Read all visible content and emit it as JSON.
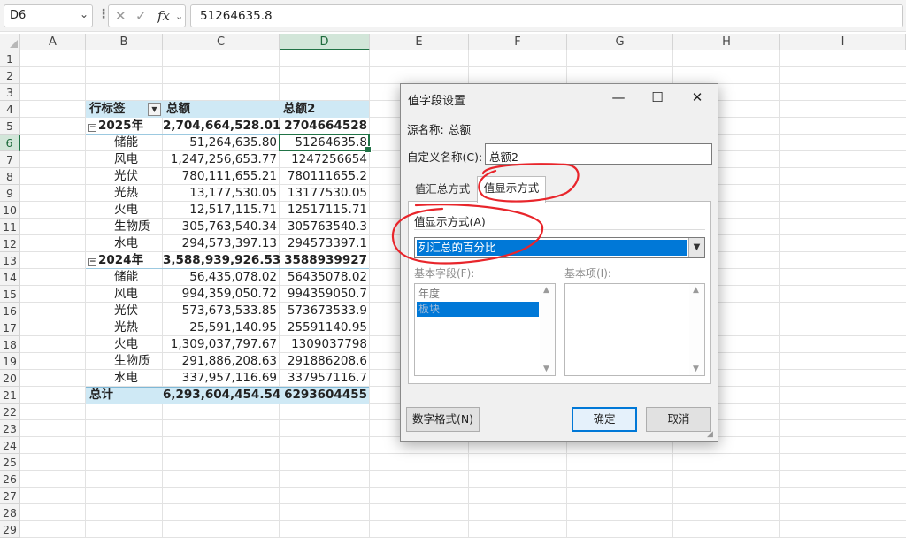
{
  "formula_bar": {
    "name_box": "D6",
    "fx_label": "fx",
    "formula_value": "51264635.8"
  },
  "columns": [
    "A",
    "B",
    "C",
    "D",
    "E",
    "F",
    "G",
    "H",
    "I"
  ],
  "rows": [
    "1",
    "2",
    "3",
    "4",
    "5",
    "6",
    "7",
    "8",
    "9",
    "10",
    "11",
    "12",
    "13",
    "14",
    "15",
    "16",
    "17",
    "18",
    "19",
    "20",
    "21",
    "22",
    "23",
    "24",
    "25",
    "26",
    "27",
    "28",
    "29"
  ],
  "active_cell": "D6",
  "pivot": {
    "headers": {
      "row_label": "行标签",
      "sum": "总额",
      "sum2": "总额2"
    },
    "groups": [
      {
        "year": "2025年",
        "sum": "2,704,664,528.01",
        "sum2": "2704664528",
        "items": [
          {
            "label": "储能",
            "sum": "51,264,635.80",
            "sum2": "51264635.8"
          },
          {
            "label": "风电",
            "sum": "1,247,256,653.77",
            "sum2": "1247256654"
          },
          {
            "label": "光伏",
            "sum": "780,111,655.21",
            "sum2": "780111655.2"
          },
          {
            "label": "光热",
            "sum": "13,177,530.05",
            "sum2": "13177530.05"
          },
          {
            "label": "火电",
            "sum": "12,517,115.71",
            "sum2": "12517115.71"
          },
          {
            "label": "生物质",
            "sum": "305,763,540.34",
            "sum2": "305763540.3"
          },
          {
            "label": "水电",
            "sum": "294,573,397.13",
            "sum2": "294573397.1"
          }
        ]
      },
      {
        "year": "2024年",
        "sum": "3,588,939,926.53",
        "sum2": "3588939927",
        "items": [
          {
            "label": "储能",
            "sum": "56,435,078.02",
            "sum2": "56435078.02"
          },
          {
            "label": "风电",
            "sum": "994,359,050.72",
            "sum2": "994359050.7"
          },
          {
            "label": "光伏",
            "sum": "573,673,533.85",
            "sum2": "573673533.9"
          },
          {
            "label": "光热",
            "sum": "25,591,140.95",
            "sum2": "25591140.95"
          },
          {
            "label": "火电",
            "sum": "1,309,037,797.67",
            "sum2": "1309037798"
          },
          {
            "label": "生物质",
            "sum": "291,886,208.63",
            "sum2": "291886208.6"
          },
          {
            "label": "水电",
            "sum": "337,957,116.69",
            "sum2": "337957116.7"
          }
        ]
      }
    ],
    "total": {
      "label": "总计",
      "sum": "6,293,604,454.54",
      "sum2": "6293604455"
    }
  },
  "dialog": {
    "title": "值字段设置",
    "source_label": "源名称:",
    "source_value": "总额",
    "custom_name_label": "自定义名称(C):",
    "custom_name_value": "总额2",
    "tabs": [
      "值汇总方式",
      "值显示方式"
    ],
    "active_tab": "值显示方式",
    "show_as_label": "值显示方式(A)",
    "show_as_value": "列汇总的百分比",
    "base_field_label": "基本字段(F):",
    "base_field_items": [
      "年度",
      "板块"
    ],
    "base_item_label": "基本项(I):",
    "number_format_button": "数字格式(N)",
    "ok_button": "确定",
    "cancel_button": "取消"
  },
  "colors": {
    "accent_green": "#217346",
    "pivot_header_fill": "#cfe9f5",
    "selection_blue": "#0078d7",
    "annotation_red": "#e8252b"
  }
}
